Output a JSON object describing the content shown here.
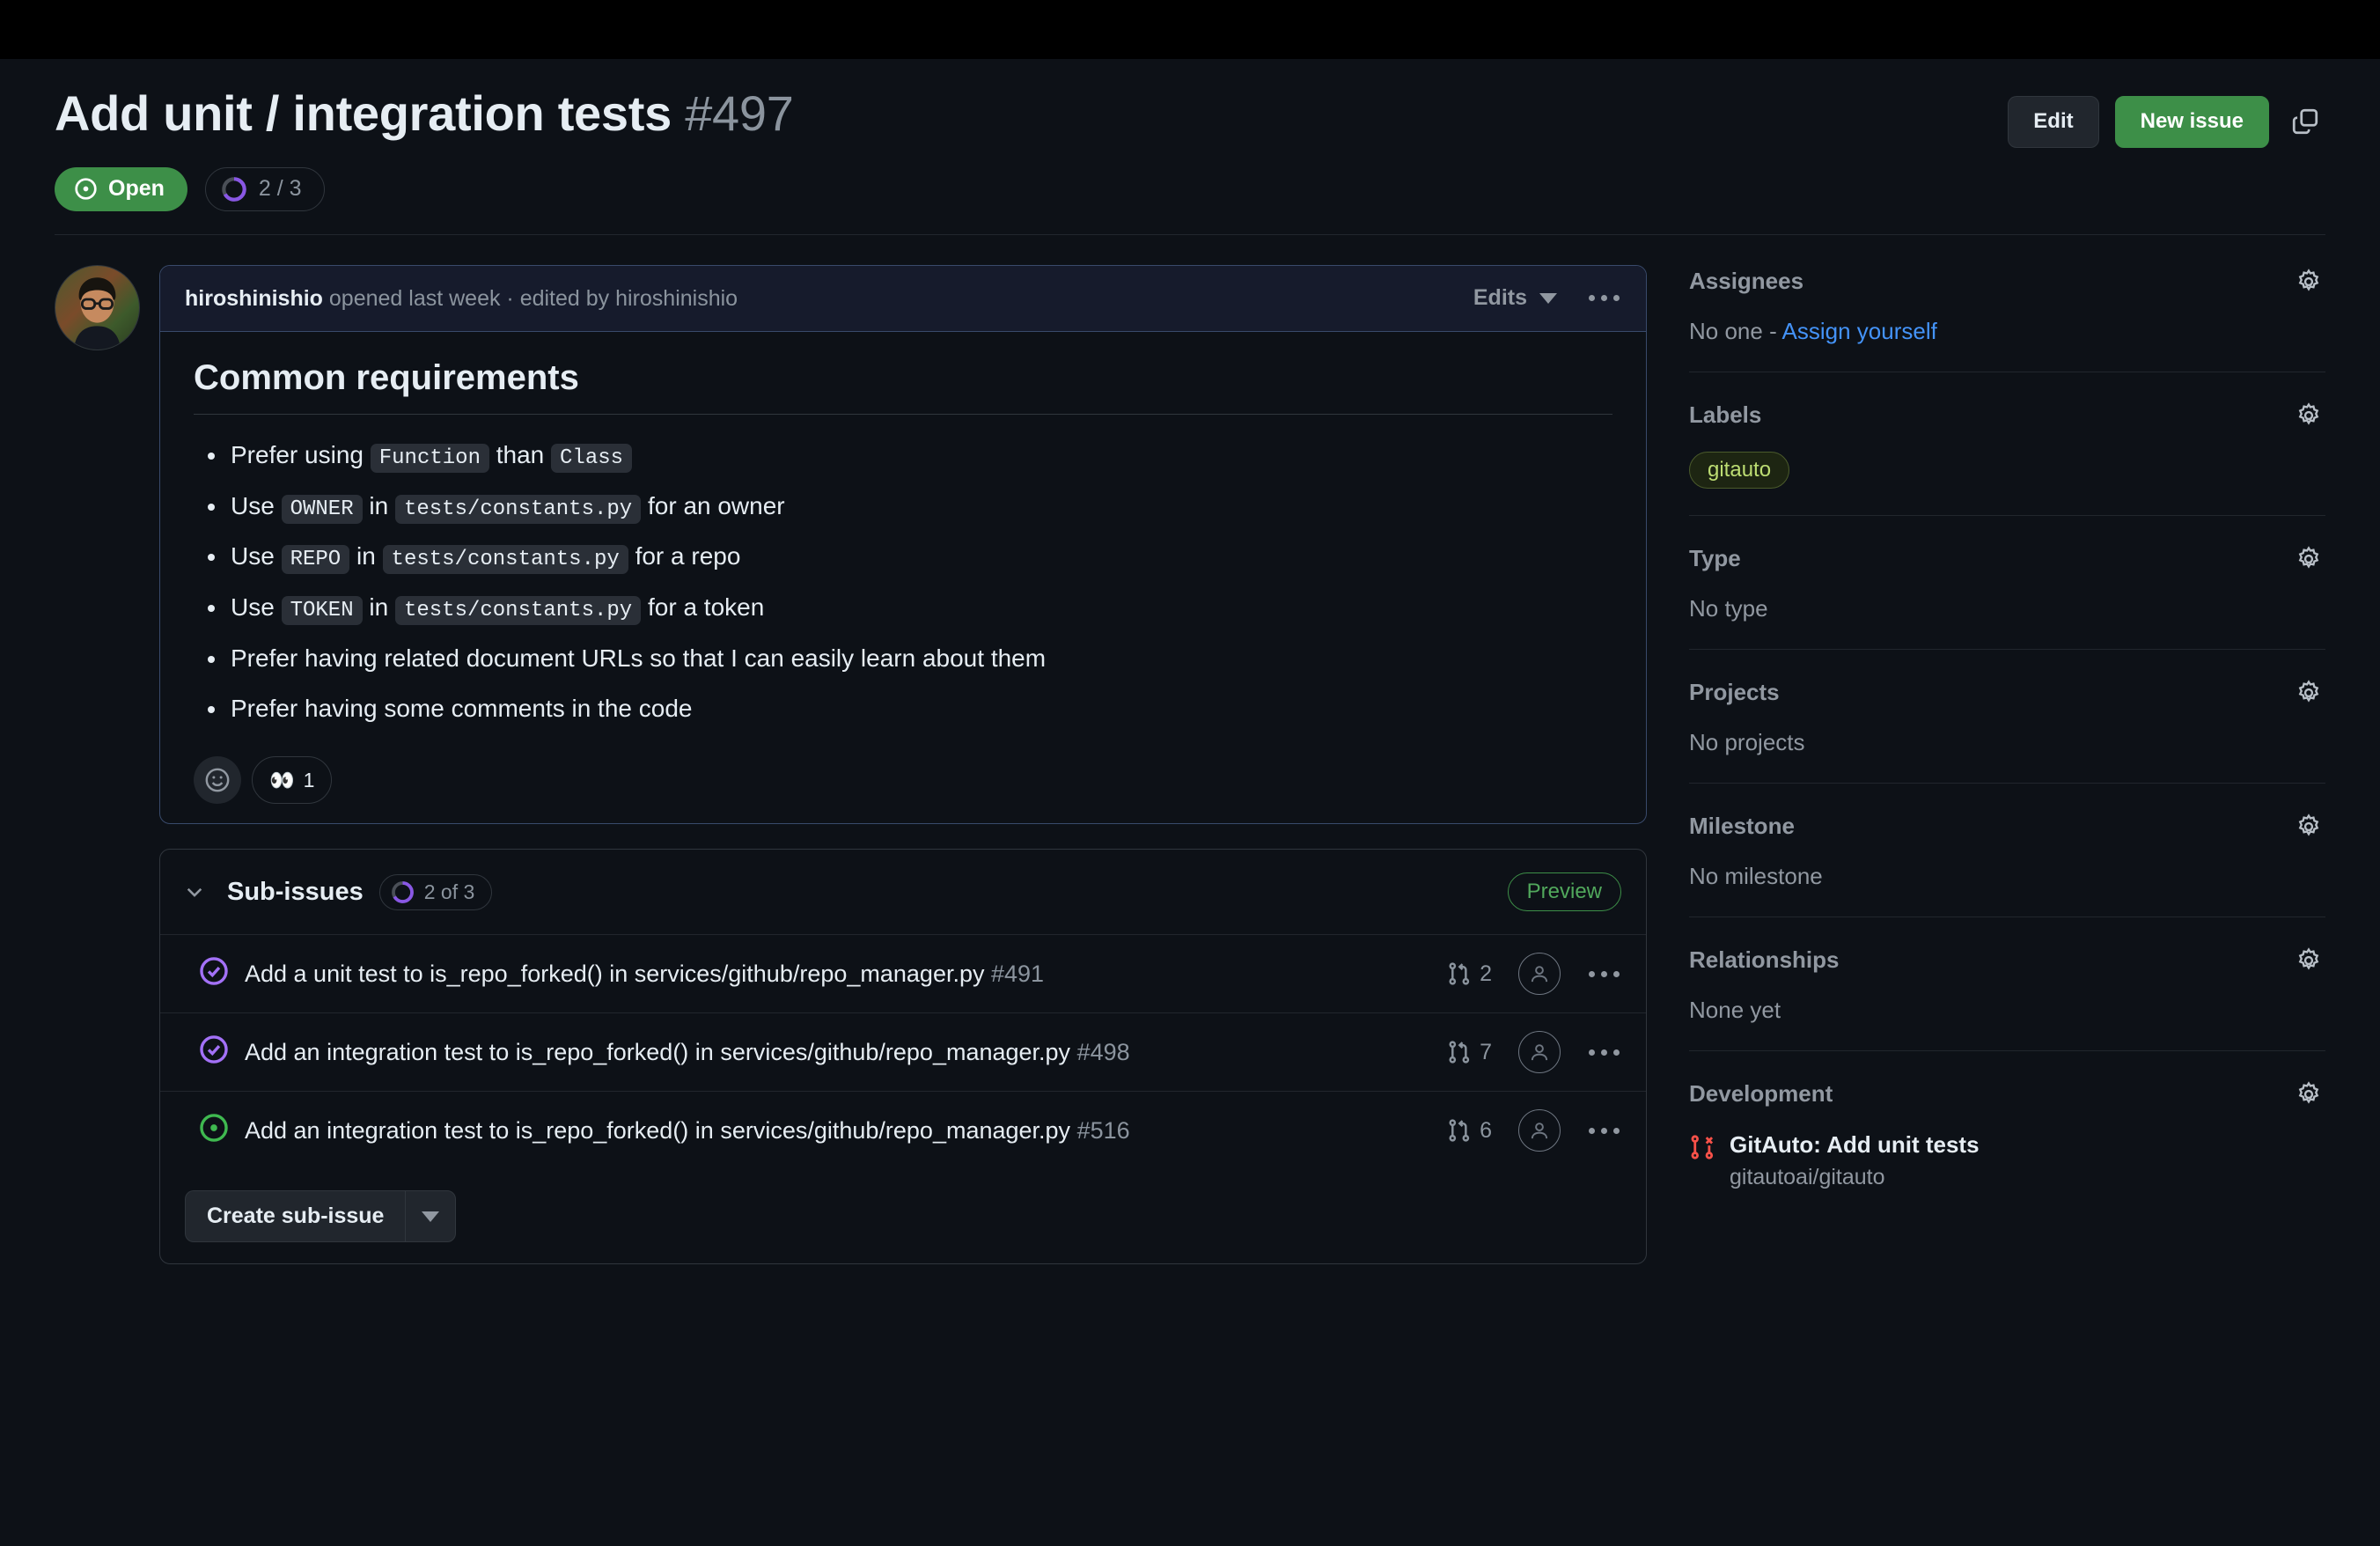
{
  "header": {
    "title": "Add unit / integration tests",
    "number": "#497",
    "edit_label": "Edit",
    "new_issue_label": "New issue",
    "copy_icon": "copy-icon",
    "state_label": "Open",
    "state_icon": "issue-open-icon",
    "state_color": "#3d8f48",
    "sub_progress": "2 / 3",
    "progress_icon": "progress-ring-icon"
  },
  "comment": {
    "author": "hiroshinishio",
    "meta_rest": " opened last week · edited by hiroshinishio",
    "edits_label": "Edits",
    "kebab_icon": "kebab-menu-icon",
    "heading": "Common requirements",
    "bullets": [
      {
        "parts": [
          {
            "t": "Prefer using ",
            "code": false
          },
          {
            "t": "Function",
            "code": true
          },
          {
            "t": " than ",
            "code": false
          },
          {
            "t": "Class",
            "code": true
          }
        ]
      },
      {
        "parts": [
          {
            "t": "Use ",
            "code": false
          },
          {
            "t": "OWNER",
            "code": true
          },
          {
            "t": " in ",
            "code": false
          },
          {
            "t": "tests/constants.py",
            "code": true
          },
          {
            "t": " for an owner",
            "code": false
          }
        ]
      },
      {
        "parts": [
          {
            "t": "Use ",
            "code": false
          },
          {
            "t": "REPO",
            "code": true
          },
          {
            "t": " in ",
            "code": false
          },
          {
            "t": "tests/constants.py",
            "code": true
          },
          {
            "t": " for a repo",
            "code": false
          }
        ]
      },
      {
        "parts": [
          {
            "t": "Use ",
            "code": false
          },
          {
            "t": "TOKEN",
            "code": true
          },
          {
            "t": " in ",
            "code": false
          },
          {
            "t": "tests/constants.py",
            "code": true
          },
          {
            "t": " for a token",
            "code": false
          }
        ]
      },
      {
        "parts": [
          {
            "t": "Prefer having related document URLs so that I can easily learn about them",
            "code": false
          }
        ]
      },
      {
        "parts": [
          {
            "t": "Prefer having some comments in the code",
            "code": false
          }
        ]
      }
    ],
    "reaction_add_icon": "add-reaction-icon",
    "reaction_emoji": "👀",
    "reaction_count": "1"
  },
  "subissues": {
    "chevron_icon": "chevron-down-icon",
    "title": "Sub-issues",
    "count_label": "2 of 3",
    "preview_label": "Preview",
    "create_label": "Create sub-issue",
    "create_caret_icon": "caret-down-icon",
    "rows": [
      {
        "state": "closed-completed",
        "state_icon": "issue-closed-check-icon",
        "text": "Add a unit test to is_repo_forked() in services/github/repo_manager.py",
        "number": "#491",
        "pr_icon": "pull-request-icon",
        "pr_count": "2",
        "assignee_icon": "assignee-placeholder-icon",
        "kebab_icon": "kebab-menu-icon"
      },
      {
        "state": "closed-completed",
        "state_icon": "issue-closed-check-icon",
        "text": "Add an integration test to is_repo_forked() in services/github/repo_manager.py",
        "number": "#498",
        "pr_icon": "pull-request-icon",
        "pr_count": "7",
        "assignee_icon": "assignee-placeholder-icon",
        "kebab_icon": "kebab-menu-icon"
      },
      {
        "state": "open",
        "state_icon": "issue-open-icon",
        "text": "Add an integration test to is_repo_forked() in services/github/repo_manager.py",
        "number": "#516",
        "pr_icon": "pull-request-icon",
        "pr_count": "6",
        "assignee_icon": "assignee-placeholder-icon",
        "kebab_icon": "kebab-menu-icon"
      }
    ]
  },
  "sidebar": {
    "assignees": {
      "title": "Assignees",
      "empty": "No one - ",
      "link": "Assign yourself",
      "gear_icon": "gear-icon"
    },
    "labels": {
      "title": "Labels",
      "gear_icon": "gear-icon",
      "chips": [
        "gitauto"
      ]
    },
    "type": {
      "title": "Type",
      "empty": "No type",
      "gear_icon": "gear-icon"
    },
    "projects": {
      "title": "Projects",
      "empty": "No projects",
      "gear_icon": "gear-icon"
    },
    "milestone": {
      "title": "Milestone",
      "empty": "No milestone",
      "gear_icon": "gear-icon"
    },
    "relationships": {
      "title": "Relationships",
      "empty": "None yet",
      "gear_icon": "gear-icon"
    },
    "development": {
      "title": "Development",
      "gear_icon": "gear-icon",
      "pr_icon": "pull-request-closed-icon",
      "item_title": "GitAuto: Add unit tests",
      "item_sub": "gitautoai/gitauto"
    }
  },
  "colors": {
    "green": "#3d8f48",
    "purple": "#8957e5",
    "blue_link": "#4493f8",
    "muted": "#9198a1",
    "bg": "#0d1117"
  }
}
